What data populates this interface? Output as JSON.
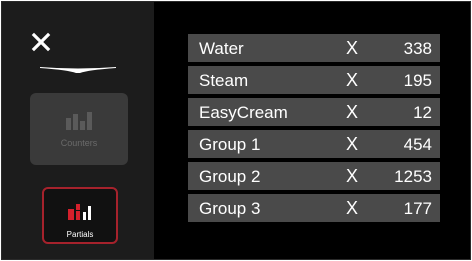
{
  "colors": {
    "background": "#000000",
    "sidebar": "#1c1c1c",
    "row": "#4a4a4a",
    "accent": "#a6222c",
    "disabled_button": "#3a3a3a"
  },
  "sidebar": {
    "close_icon": "close-icon",
    "buttons": [
      {
        "label": "Counters",
        "icon": "bar-chart-icon",
        "state": "disabled"
      },
      {
        "label": "Partials",
        "icon": "bar-chart-icon",
        "state": "selected"
      }
    ]
  },
  "counters": [
    {
      "name": "Water",
      "separator": "X",
      "count": "338"
    },
    {
      "name": "Steam",
      "separator": "X",
      "count": "195"
    },
    {
      "name": "EasyCream",
      "separator": "X",
      "count": "12"
    },
    {
      "name": "Group 1",
      "separator": "X",
      "count": "454"
    },
    {
      "name": "Group 2",
      "separator": "X",
      "count": "1253"
    },
    {
      "name": "Group 3",
      "separator": "X",
      "count": "177"
    }
  ]
}
